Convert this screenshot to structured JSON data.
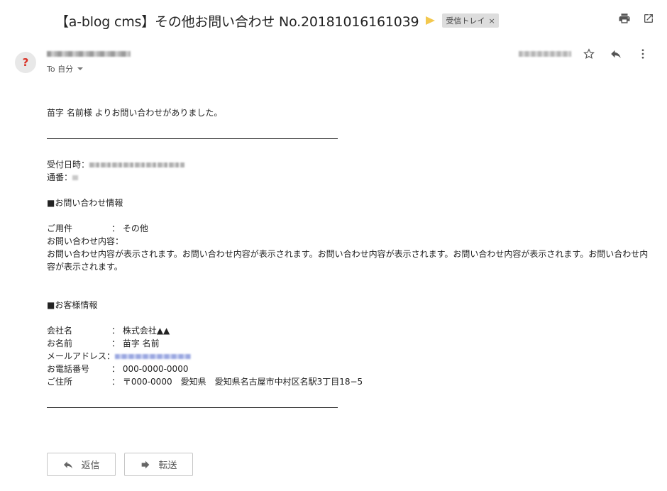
{
  "email": {
    "subject": "【a-blog cms】その他お問い合わせ No.20181016161039",
    "label": "受信トレイ",
    "label_close": "×",
    "sender_initial": "?",
    "to_text": "To 自分"
  },
  "body": {
    "intro": "苗字 名前様 よりお問い合わせがありました。",
    "received_label": "受付日時：",
    "number_label": "通番：",
    "inquiry_heading": "■お問い合わせ情報",
    "purpose_label": "ご用件",
    "purpose_value": "： その他",
    "content_label": "お問い合わせ内容：",
    "content_text": "お問い合わせ内容が表示されます。お問い合わせ内容が表示されます。お問い合わせ内容が表示されます。お問い合わせ内容が表示されます。お問い合わせ内容が表示されます。",
    "customer_heading": "■お客様情報",
    "company_label": "会社名",
    "company_value": "： 株式会社▲▲",
    "name_label": "お名前",
    "name_value": "： 苗字 名前",
    "email_label": "メールアドレス：",
    "phone_label": "お電話番号",
    "phone_value": "： 000-0000-0000",
    "address_label": "ご住所",
    "address_value": "： 〒000-0000　愛知県　愛知県名古屋市中村区名駅3丁目18−5"
  },
  "actions": {
    "reply_label": "返信",
    "forward_label": "転送"
  },
  "icons": [
    "print-icon",
    "open-in-new-window-icon",
    "star-icon",
    "reply-icon",
    "more-vert-icon",
    "reply-arrow-icon",
    "forward-arrow-icon"
  ],
  "colors": {
    "important_marker": "#f3c84e",
    "avatar_question": "#d93025",
    "label_chip_bg": "#dddddd"
  }
}
